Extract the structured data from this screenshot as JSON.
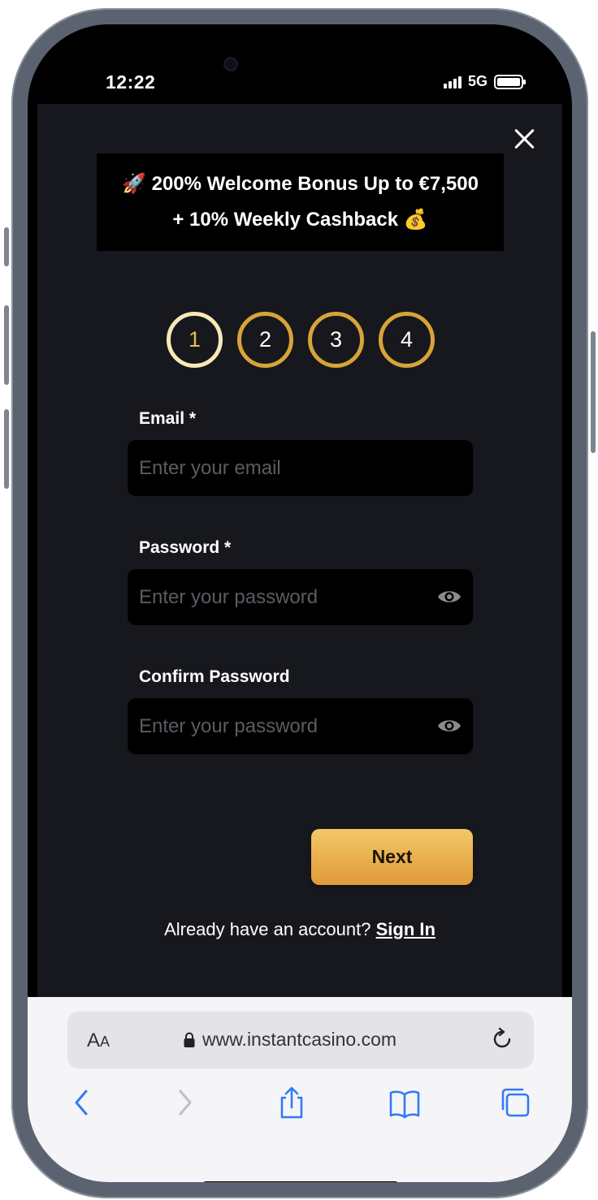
{
  "status_bar": {
    "time": "12:22",
    "network": "5G"
  },
  "modal": {
    "banner": {
      "rocket_emoji": "🚀",
      "line1": "200% Welcome Bonus Up to €7,500",
      "line2": "+ 10% Weekly Cashback",
      "money_emoji": "💰"
    },
    "steps": [
      {
        "label": "1",
        "active": true
      },
      {
        "label": "2",
        "active": false
      },
      {
        "label": "3",
        "active": false
      },
      {
        "label": "4",
        "active": false
      }
    ],
    "fields": {
      "email": {
        "label": "Email *",
        "placeholder": "Enter your email"
      },
      "password": {
        "label": "Password *",
        "placeholder": "Enter your password"
      },
      "confirm_password": {
        "label": "Confirm Password",
        "placeholder": "Enter your password"
      }
    },
    "next_label": "Next",
    "signin_prompt": "Already have an account?",
    "signin_link": "Sign In"
  },
  "browser": {
    "aa_big": "A",
    "aa_small": "A",
    "url": "www.instantcasino.com"
  },
  "colors": {
    "accent_gold": "#d6a437",
    "active_step_ring": "#f7e8b7",
    "button_top": "#f2c866",
    "button_bottom": "#e09a3a",
    "modal_bg": "#17181d"
  }
}
